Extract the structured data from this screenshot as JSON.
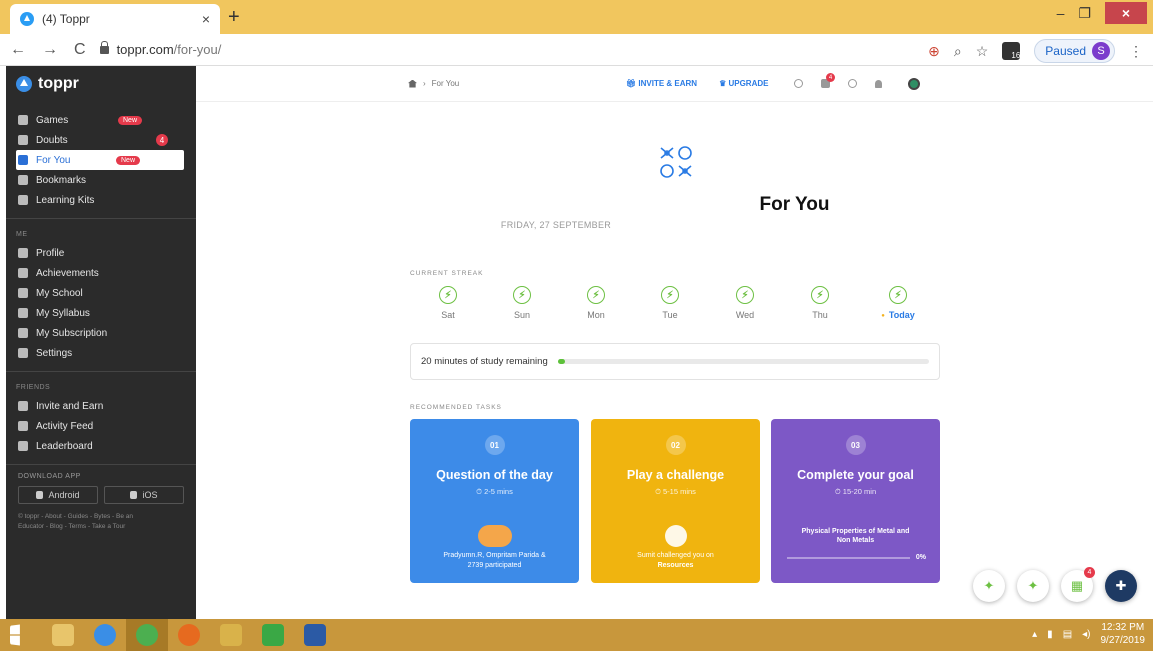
{
  "browser": {
    "tab_title": "(4) Toppr",
    "tab_close": "×",
    "new_tab": "+",
    "url_host": "toppr.com",
    "url_path": "/for-you/",
    "paused_label": "Paused",
    "profile_initial": "S",
    "ext_badge": "16",
    "win_min": "–",
    "win_max": "❐",
    "win_close": "×"
  },
  "sidebar": {
    "logo": "toppr",
    "items_top": [
      {
        "label": "Games",
        "badge": "New"
      },
      {
        "label": "Doubts",
        "count": "4"
      },
      {
        "label": "For You",
        "badge": "New",
        "active": true
      },
      {
        "label": "Bookmarks"
      },
      {
        "label": "Learning Kits"
      }
    ],
    "me_heading": "ME",
    "items_me": [
      {
        "label": "Profile"
      },
      {
        "label": "Achievements"
      },
      {
        "label": "My School"
      },
      {
        "label": "My Syllabus"
      },
      {
        "label": "My Subscription"
      },
      {
        "label": "Settings"
      }
    ],
    "friends_heading": "FRIENDS",
    "items_friends": [
      {
        "label": "Invite and Earn"
      },
      {
        "label": "Activity Feed"
      },
      {
        "label": "Leaderboard"
      }
    ],
    "download_heading": "DOWNLOAD APP",
    "android_label": "Android",
    "ios_label": "iOS",
    "footer_line1": "© toppr - About - Guides - Bytes - Be an",
    "footer_line2": "Educator - Blog - Terms - Take a Tour"
  },
  "topnav": {
    "breadcrumb": "For You",
    "invite_label": "INVITE & EARN",
    "upgrade_label": "UPGRADE",
    "msg_badge": "4"
  },
  "page": {
    "title": "For You",
    "date": "FRIDAY, 27 SEPTEMBER",
    "streak_heading": "CURRENT STREAK",
    "days": [
      "Sat",
      "Sun",
      "Mon",
      "Tue",
      "Wed",
      "Thu",
      "Today"
    ],
    "study_remaining": "20 minutes of study remaining",
    "study_progress_fraction": 0.02,
    "recommended_heading": "RECOMMENDED TASKS"
  },
  "cards": [
    {
      "num": "01",
      "title": "Question of the day",
      "time": "2-5 mins",
      "foot1": "Pradyumn.R, Ompritam Parida &",
      "foot2": "2739 participated",
      "color": "#3d8be8"
    },
    {
      "num": "02",
      "title": "Play a challenge",
      "time": "5-15 mins",
      "foot1": "Sumit challenged you on",
      "foot2": "Resources",
      "color": "#f0b40f"
    },
    {
      "num": "03",
      "title": "Complete your goal",
      "time": "15-20 min",
      "foot1": "Physical Properties of Metal and",
      "foot2": "Non Metals",
      "progress": "0%",
      "color": "#7d58c6"
    }
  ],
  "floating": {
    "grid_badge": "4"
  },
  "taskbar": {
    "time": "12:32 PM",
    "date": "9/27/2019"
  }
}
